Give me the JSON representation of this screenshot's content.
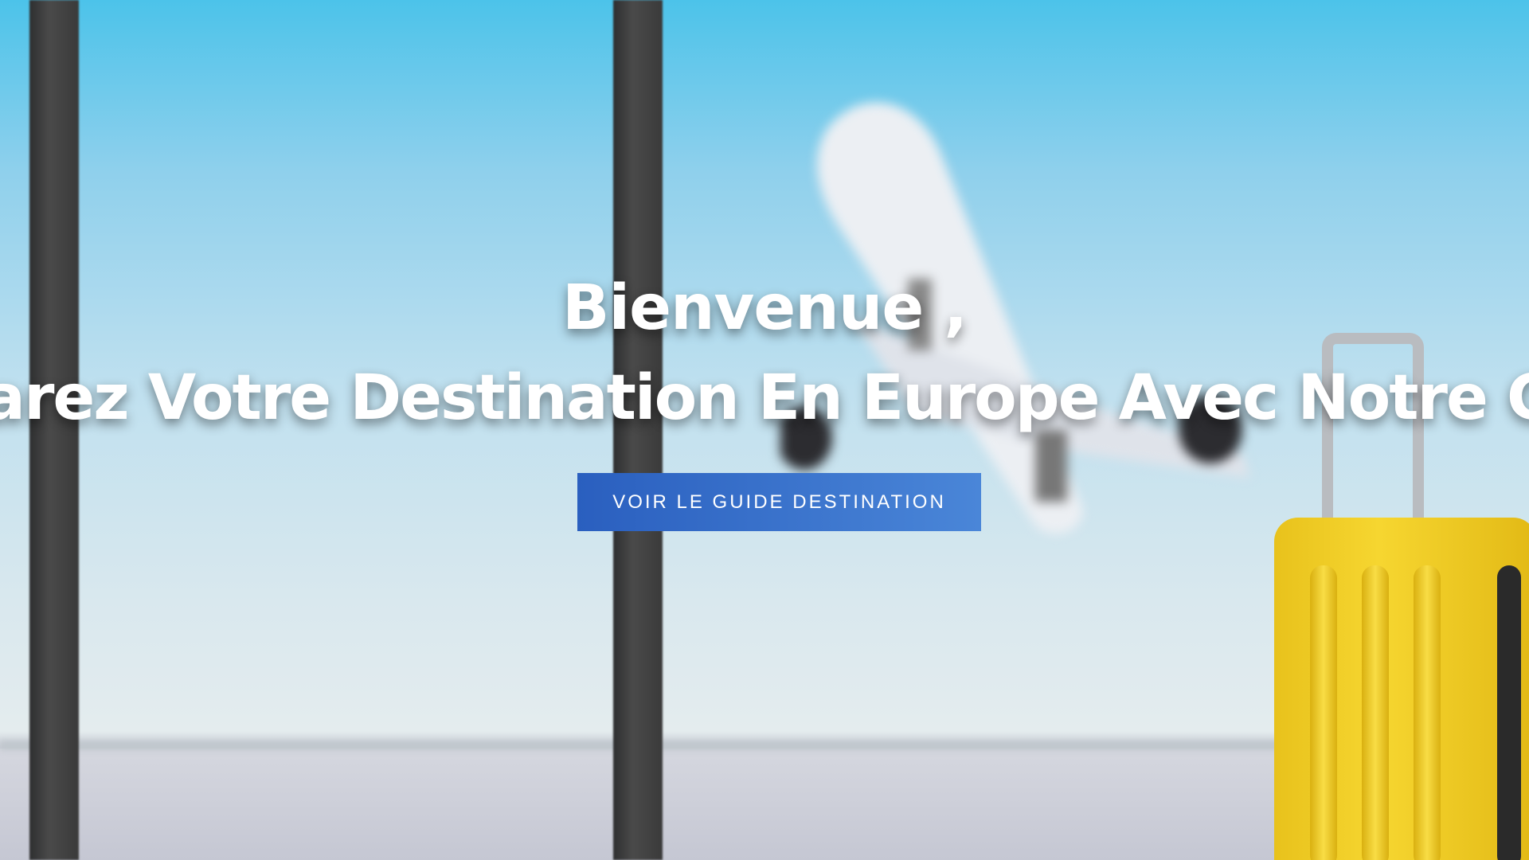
{
  "hero": {
    "welcome": "Bienvenue ,",
    "subtitle": "Préparez Votre Destination En Europe Avec Notre Guide",
    "cta_label": "VOIR LE GUIDE DESTINATION",
    "cta_color": "#3d78d0"
  }
}
